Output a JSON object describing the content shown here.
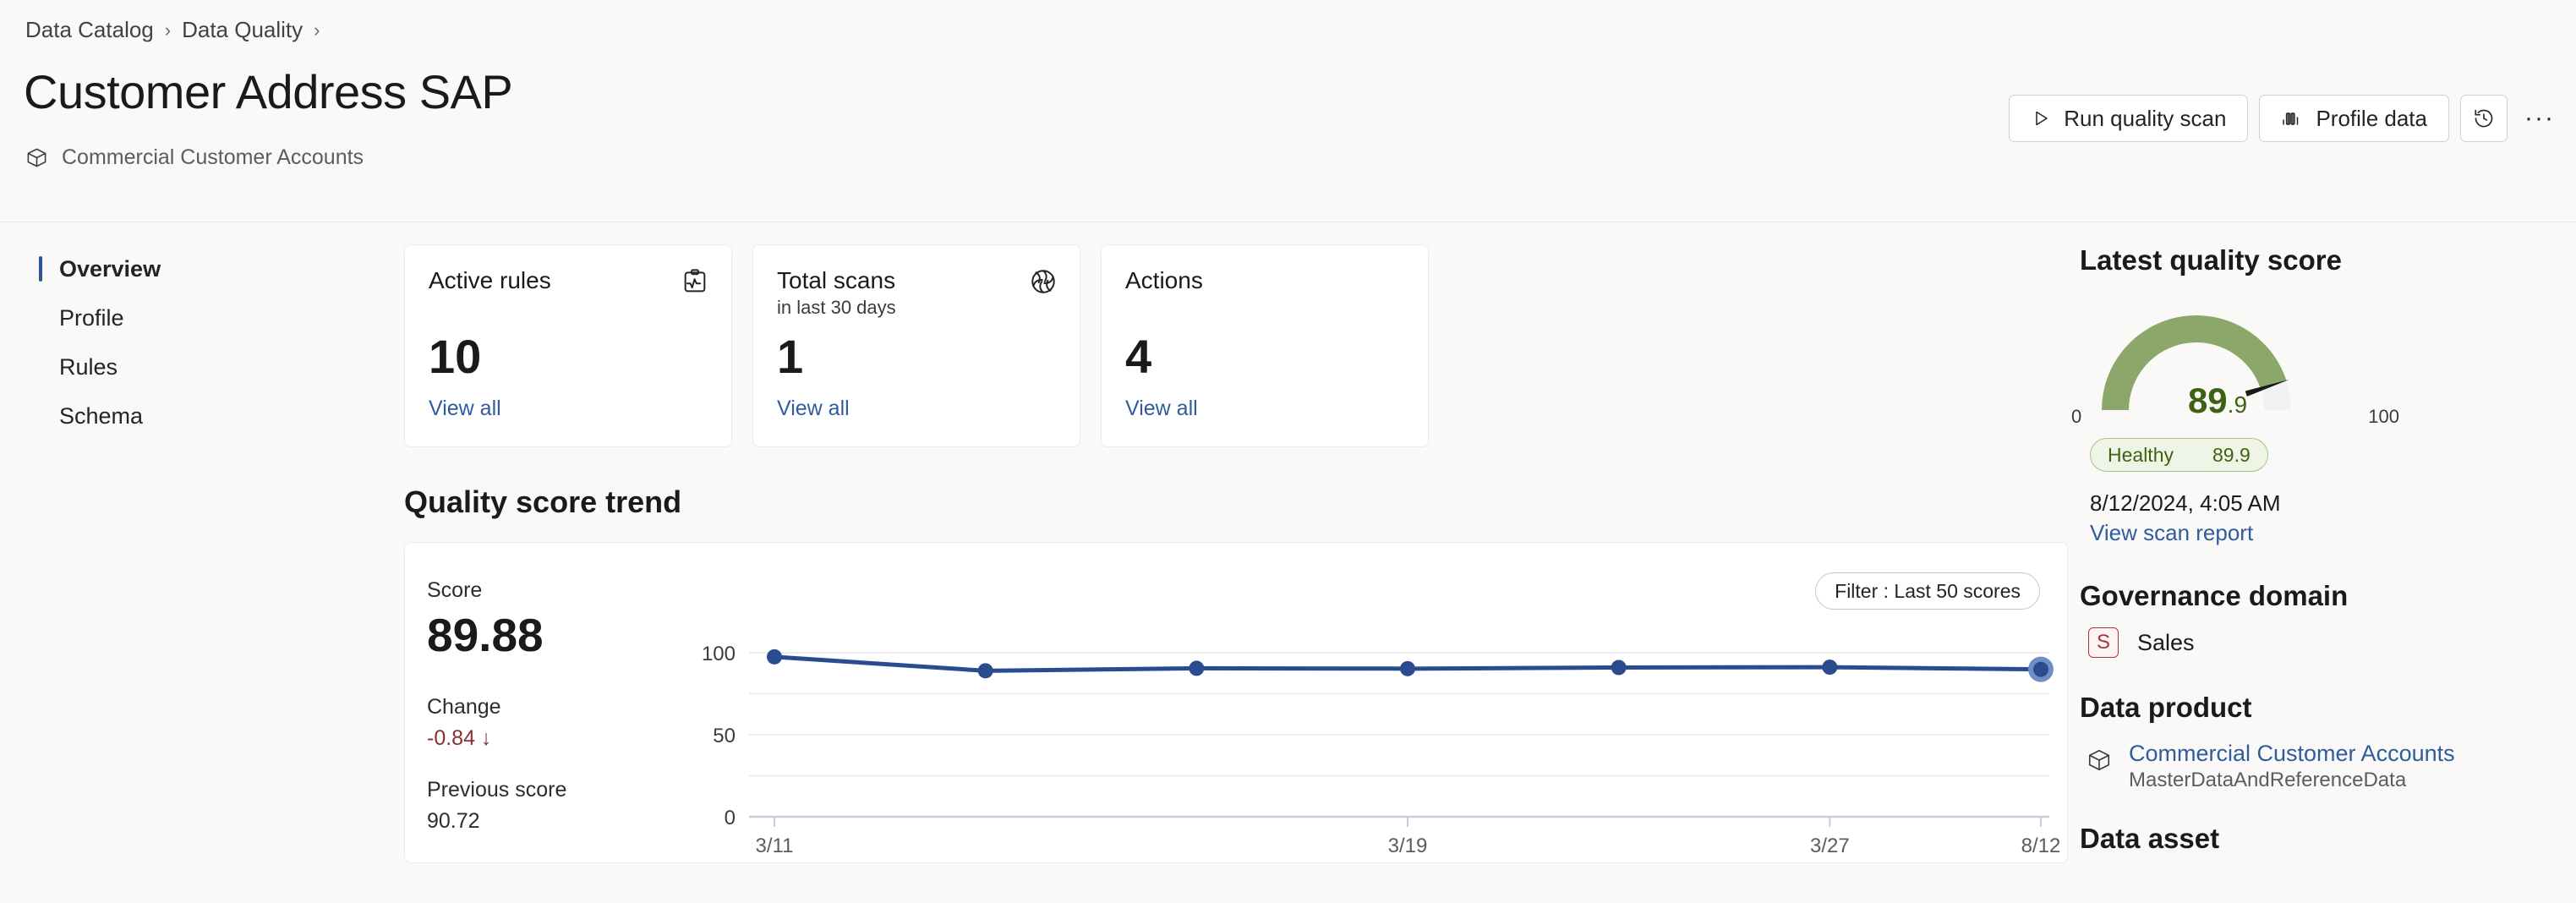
{
  "breadcrumb": {
    "items": [
      {
        "label": "Data Catalog"
      },
      {
        "label": "Data Quality"
      }
    ],
    "separator": "›"
  },
  "header": {
    "title": "Customer Address SAP",
    "subtitle": "Commercial Customer Accounts",
    "subtitle_icon": "package-icon",
    "actions": {
      "run_quality_scan": "Run quality scan",
      "profile_data": "Profile data",
      "history_icon": "history-icon",
      "more_icon": "ellipsis-icon",
      "more_label": "···"
    }
  },
  "sidebar": {
    "items": [
      {
        "label": "Overview",
        "active": true
      },
      {
        "label": "Profile",
        "active": false
      },
      {
        "label": "Rules",
        "active": false
      },
      {
        "label": "Schema",
        "active": false
      }
    ]
  },
  "cards": [
    {
      "title": "Active rules",
      "subtitle": "",
      "value": "10",
      "link": "View all",
      "icon": "clipboard-pulse-icon"
    },
    {
      "title": "Total scans",
      "subtitle": "in last 30 days",
      "value": "1",
      "link": "View all",
      "icon": "aperture-scan-icon"
    },
    {
      "title": "Actions",
      "subtitle": "",
      "value": "4",
      "link": "View all",
      "icon": ""
    }
  ],
  "trend": {
    "section_title": "Quality score trend",
    "filter_label": "Filter : Last 50 scores",
    "score_label": "Score",
    "score_value": "89.88",
    "change_label": "Change",
    "change_value": "-0.84 ↓",
    "previous_label": "Previous score",
    "previous_value": "90.72"
  },
  "chart_data": {
    "type": "line",
    "title": "Quality score trend",
    "xlabel": "",
    "ylabel": "",
    "ylim": [
      0,
      100
    ],
    "yticks": [
      0,
      50,
      100
    ],
    "ytick_labels": [
      "0",
      "50",
      "100"
    ],
    "xticks": [
      "3/11",
      "3/19",
      "3/27",
      "8/12"
    ],
    "grid": true,
    "legend": "none",
    "series": [
      {
        "name": "Quality score",
        "color": "#2a4b8d",
        "x": [
          "3/11",
          "3/13",
          "3/17",
          "3/19",
          "3/23",
          "3/27",
          "8/12"
        ],
        "values": [
          97.5,
          89.0,
          90.5,
          90.3,
          91.0,
          91.2,
          89.88
        ]
      }
    ],
    "highlight_index": 6
  },
  "right": {
    "quality_heading": "Latest quality score",
    "gauge": {
      "min": "0",
      "max": "100",
      "value_whole": "89",
      "value_frac": ".9",
      "value": 89.9,
      "arc_color": "#8ba86a",
      "track_color": "#f2f2f2",
      "needle_color": "#1b1a19"
    },
    "status": {
      "label": "Healthy",
      "score": "89.9"
    },
    "scan_date": "8/12/2024, 4:05 AM",
    "scan_report_link": "View scan report",
    "governance": {
      "heading": "Governance domain",
      "badge": "S",
      "name": "Sales"
    },
    "data_product": {
      "heading": "Data product",
      "icon": "package-icon",
      "name": "Commercial Customer Accounts",
      "subtitle": "MasterDataAndReferenceData"
    },
    "data_asset": {
      "heading": "Data asset"
    }
  }
}
